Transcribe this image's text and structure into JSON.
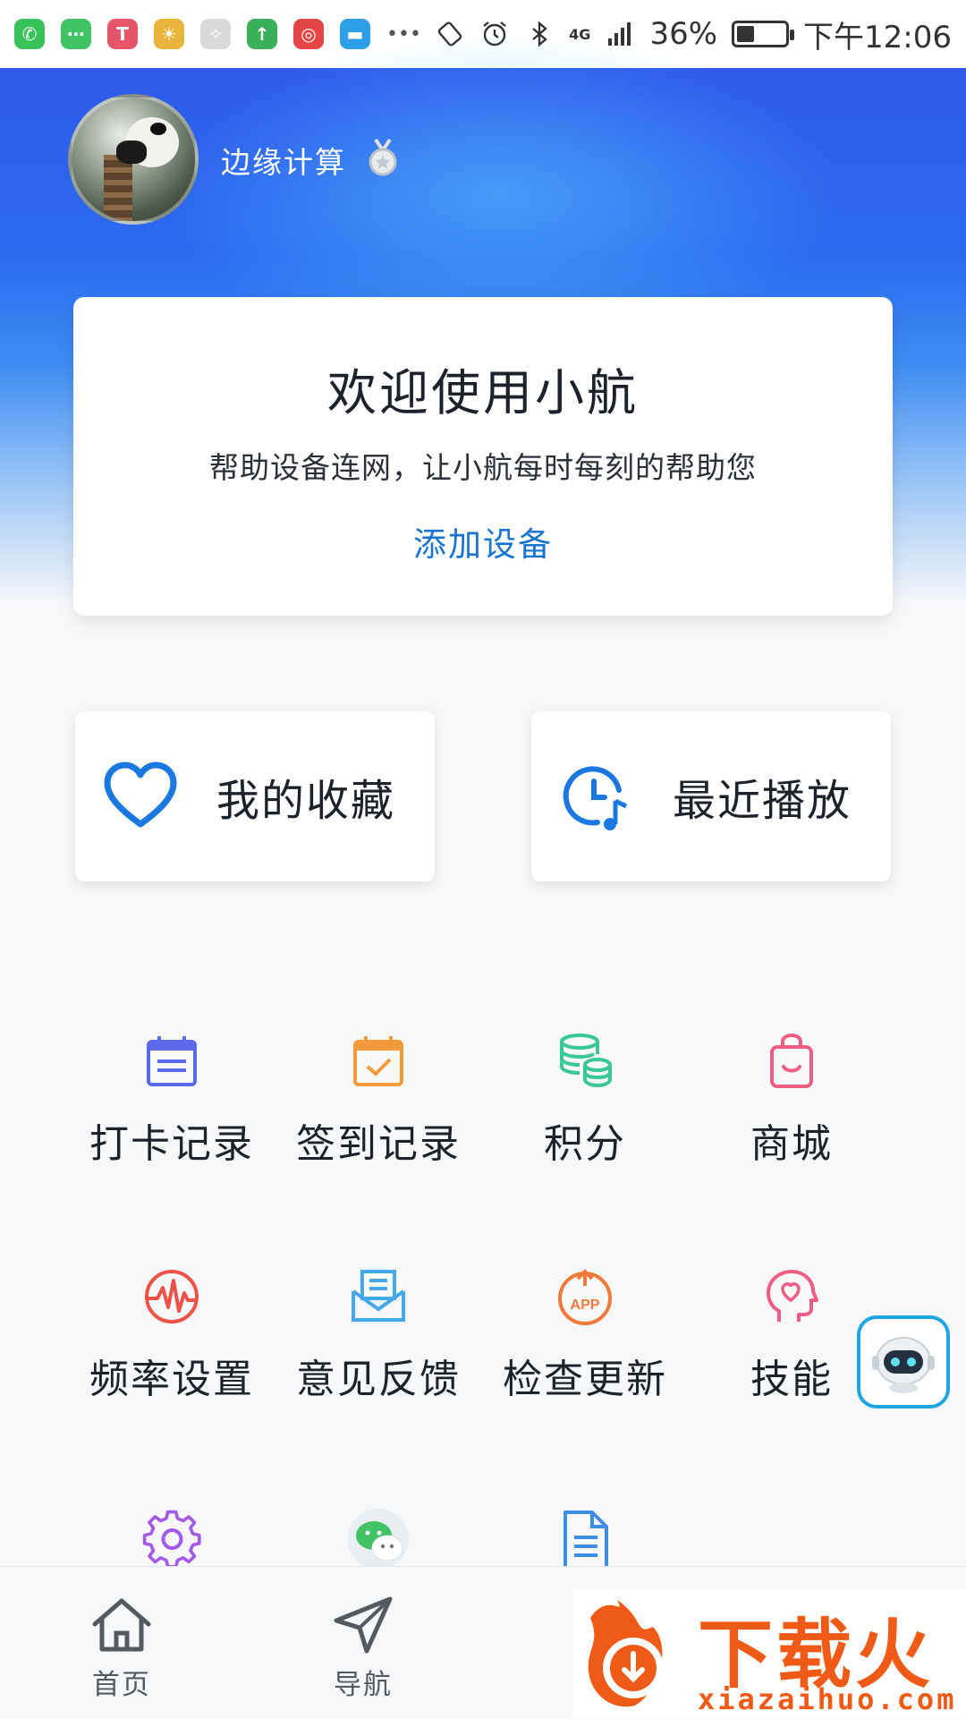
{
  "status_bar": {
    "apps": [
      {
        "name": "phone-app-icon",
        "color": "#39c25a",
        "glyph": "✆"
      },
      {
        "name": "messages-app-icon",
        "color": "#41c264",
        "glyph": "⋯"
      },
      {
        "name": "tmall-app-icon",
        "color": "#e6556a",
        "glyph": "T"
      },
      {
        "name": "weather-app-icon",
        "color": "#e9b43c",
        "glyph": "☀"
      },
      {
        "name": "compass-app-icon",
        "color": "#d9d9d9",
        "glyph": "✧"
      },
      {
        "name": "upload-app-icon",
        "color": "#3bb05b",
        "glyph": "↑"
      },
      {
        "name": "music-app-icon",
        "color": "#e64545",
        "glyph": "◎"
      },
      {
        "name": "folder-app-icon",
        "color": "#2f9ee8",
        "glyph": "▬"
      }
    ],
    "more": "•••",
    "network": "4G",
    "battery_percent": "36%",
    "battery_level": 0.36,
    "time": "下午12:06"
  },
  "profile": {
    "username": "边缘计算"
  },
  "welcome_card": {
    "title": "欢迎使用小航",
    "subtitle": "帮助设备连网，让小航每时每刻的帮助您",
    "action": "添加设备"
  },
  "shortcuts": [
    {
      "label": "我的收藏",
      "icon": "heart-icon"
    },
    {
      "label": "最近播放",
      "icon": "clock-music-icon"
    }
  ],
  "grid": [
    {
      "label": "打卡记录",
      "icon": "calendar-list-icon",
      "color": "#5a6ae8"
    },
    {
      "label": "签到记录",
      "icon": "calendar-check-icon",
      "color": "#f29a3a"
    },
    {
      "label": "积分",
      "icon": "coins-icon",
      "color": "#3cc79a"
    },
    {
      "label": "商城",
      "icon": "shopping-bag-icon",
      "color": "#ee5d86"
    },
    {
      "label": "频率设置",
      "icon": "frequency-icon",
      "color": "#ee5246"
    },
    {
      "label": "意见反馈",
      "icon": "feedback-mail-icon",
      "color": "#45a8ea"
    },
    {
      "label": "检查更新",
      "icon": "app-update-icon",
      "color": "#f07a3a"
    },
    {
      "label": "技能",
      "icon": "skill-head-icon",
      "color": "#ee5d86"
    },
    {
      "label": "",
      "icon": "gear-icon",
      "color": "#a35ae8"
    },
    {
      "label": "",
      "icon": "wechat-icon",
      "color": "#41c264"
    },
    {
      "label": "",
      "icon": "document-icon",
      "color": "#3e8ee8"
    }
  ],
  "tabbar": [
    {
      "label": "首页",
      "icon": "home-icon"
    },
    {
      "label": "导航",
      "icon": "navigation-icon"
    }
  ],
  "watermark": {
    "text": "下载火",
    "url": "xiazaihuo.com"
  }
}
